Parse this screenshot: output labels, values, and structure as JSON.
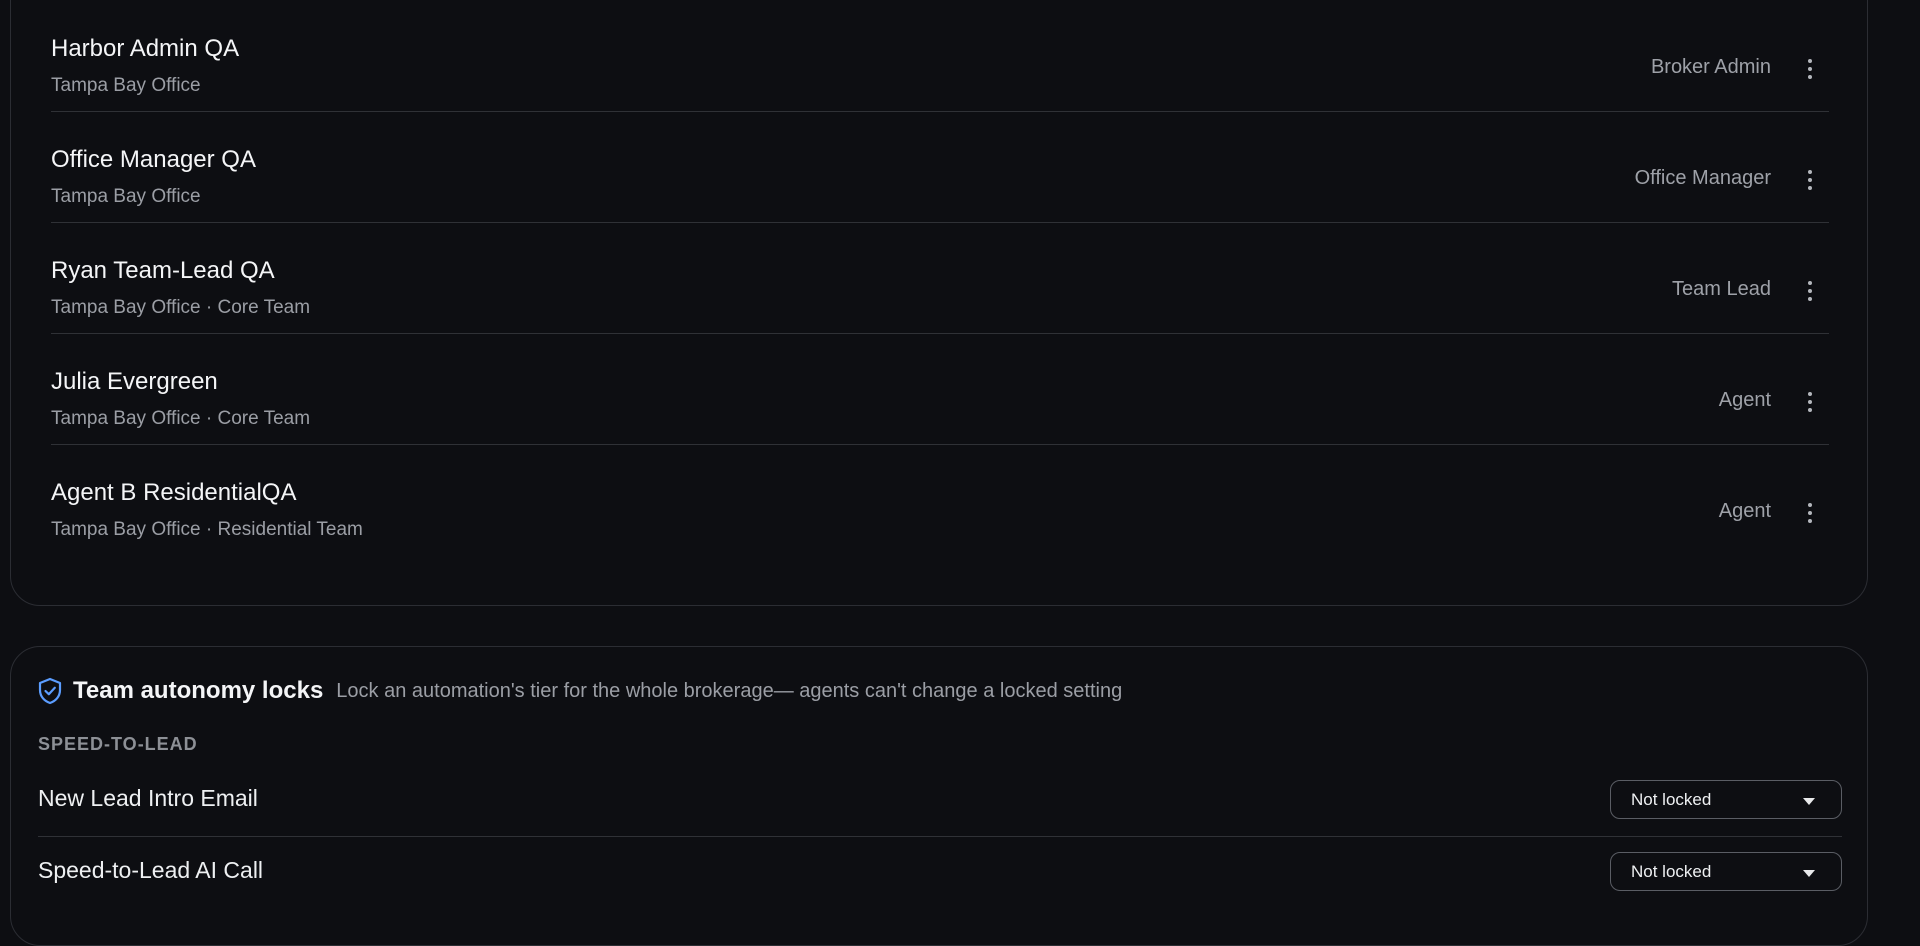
{
  "members": [
    {
      "name": "Harbor Admin QA",
      "subtitle": "Tampa Bay Office",
      "role": "Broker Admin"
    },
    {
      "name": "Office Manager QA",
      "subtitle": "Tampa Bay Office",
      "role": "Office Manager"
    },
    {
      "name": "Ryan Team-Lead QA",
      "subtitle": "Tampa Bay Office · Core Team",
      "role": "Team Lead"
    },
    {
      "name": "Julia Evergreen",
      "subtitle": "Tampa Bay Office · Core Team",
      "role": "Agent"
    },
    {
      "name": "Agent B ResidentialQA",
      "subtitle": "Tampa Bay Office · Residential Team",
      "role": "Agent"
    }
  ],
  "autonomy_locks": {
    "icon": "shield-check-icon",
    "title": "Team autonomy locks",
    "description": "Lock an automation's tier for the whole brokerage— agents can't change a locked setting",
    "section_label": "SPEED-TO-LEAD",
    "automations": [
      {
        "name": "New Lead Intro Email",
        "lock_value": "Not locked"
      },
      {
        "name": "Speed-to-Lead AI Call",
        "lock_value": "Not locked"
      }
    ]
  },
  "colors": {
    "background": "#0d0e12",
    "card_border": "#2b2d33",
    "accent_icon": "#5b9dff",
    "text_primary": "#f4f5f7",
    "text_secondary": "#9b9ea5"
  }
}
